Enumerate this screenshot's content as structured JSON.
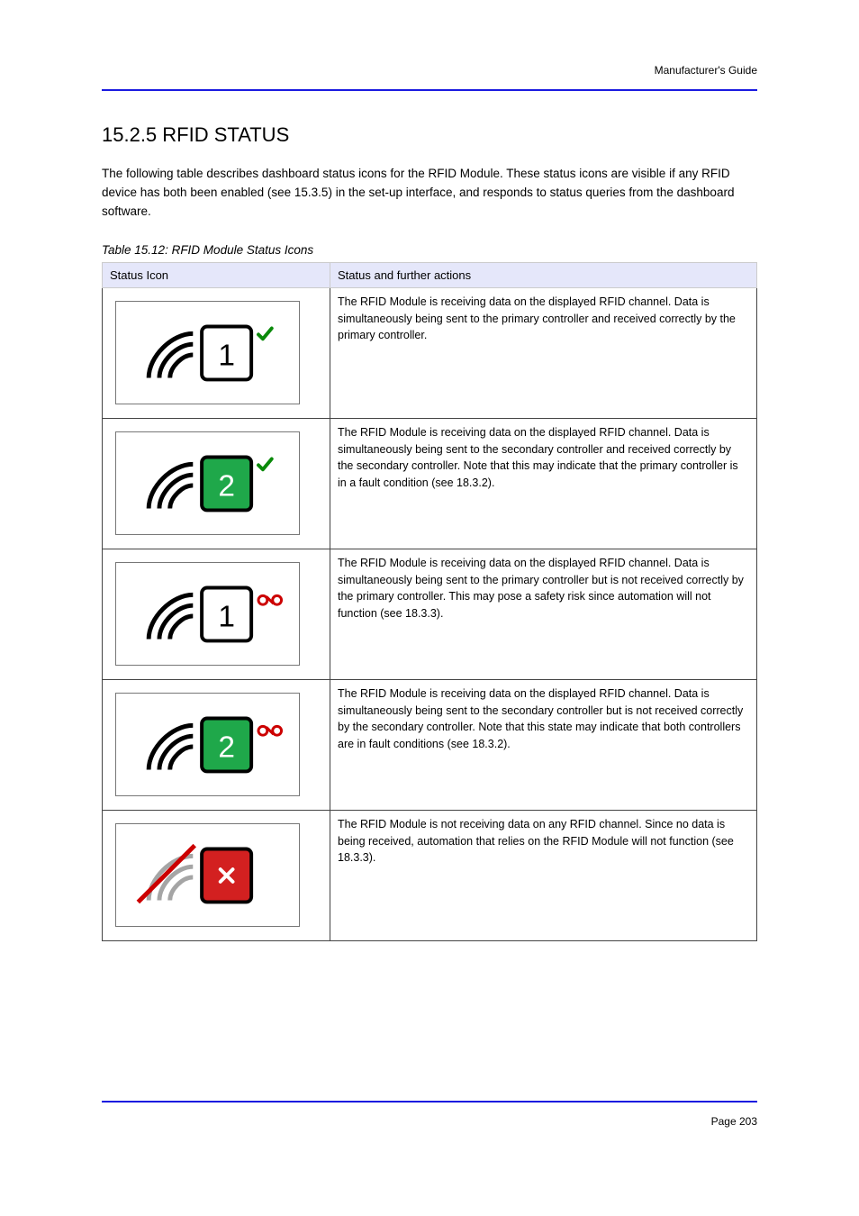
{
  "header": {
    "right": "Manufacturer's Guide"
  },
  "footer": {
    "right": "Page 203"
  },
  "title": "15.2.5 RFID STATUS",
  "body": "The following table describes dashboard status icons for the RFID Module. These status icons are visible if any RFID device has both been enabled (see 15.3.5) in the set-up interface, and responds to status queries from the dashboard software.",
  "tableCaption": "Table 15.12: RFID Module Status Icons",
  "tableHeaders": [
    "Status Icon",
    "Status and further actions"
  ],
  "rows": [
    {
      "imageAlt": "RFID icon – number-one, outline, tick",
      "svg": "icon-rfid-1-outline-tick",
      "desc": "The RFID Module is receiving data on the displayed RFID channel. Data is simultaneously being sent to the primary controller and received correctly by the primary controller."
    },
    {
      "imageAlt": "RFID icon – number-two, green background, tick",
      "svg": "icon-rfid-2-green-tick",
      "desc": "The RFID Module is receiving data on the displayed RFID channel. Data is simultaneously being sent to the secondary controller and received correctly by the secondary controller. Note that this may indicate that the primary controller is in a fault condition (see 18.3.2)."
    },
    {
      "imageAlt": "RFID icon – number-one, outline, broken chain",
      "svg": "icon-rfid-1-outline-broken",
      "desc": "The RFID Module is receiving data on the displayed RFID channel. Data is simultaneously being sent to the primary controller but is not received correctly by the primary controller. This may pose a safety risk since automation will not function (see 18.3.3)."
    },
    {
      "imageAlt": "RFID icon – number-two, green background, broken chain",
      "svg": "icon-rfid-2-green-broken",
      "desc": "The RFID Module is receiving data on the displayed RFID channel. Data is simultaneously being sent to the secondary controller but is not received correctly by the secondary controller. Note that this state may indicate that both controllers are in fault conditions (see 18.3.2)."
    },
    {
      "imageAlt": "RFID icon – cross, red background, no RFID",
      "svg": "icon-rfid-x-red-nosignal",
      "desc": "The RFID Module is not receiving data on any RFID channel. Since no data is being received, automation that relies on the RFID Module will not function (see 18.3.3)."
    }
  ]
}
